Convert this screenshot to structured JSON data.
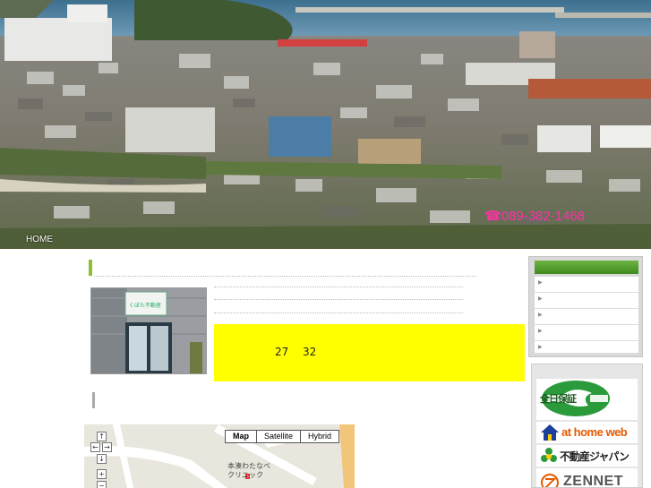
{
  "header": {
    "home_label": "HOME",
    "phone": "☎089-382-1468"
  },
  "store_photo": {
    "sign_text": "くぼた不動産"
  },
  "info_box": {
    "value_1": "27",
    "value_2": "32"
  },
  "map": {
    "types": [
      "Map",
      "Satellite",
      "Hybrid"
    ],
    "active_type": "Map",
    "place_label": "本湊わたなべ\nクリニック"
  },
  "sidebar": {
    "nav_item_count_note": "",
    "nav_items": [
      "",
      "",
      "",
      "",
      ""
    ]
  },
  "banners": {
    "zennichi": "全日保証",
    "athome": "at home web",
    "fudosan_japan": "不動産ジャパン",
    "zennet": "ZENNET"
  },
  "colors": {
    "accent_green": "#8fbf30",
    "info_box_bg": "#ffff00",
    "phone": "#ff2fa6",
    "athome_orange": "#e65a00",
    "fudosan_green": "#2a9a3a"
  }
}
